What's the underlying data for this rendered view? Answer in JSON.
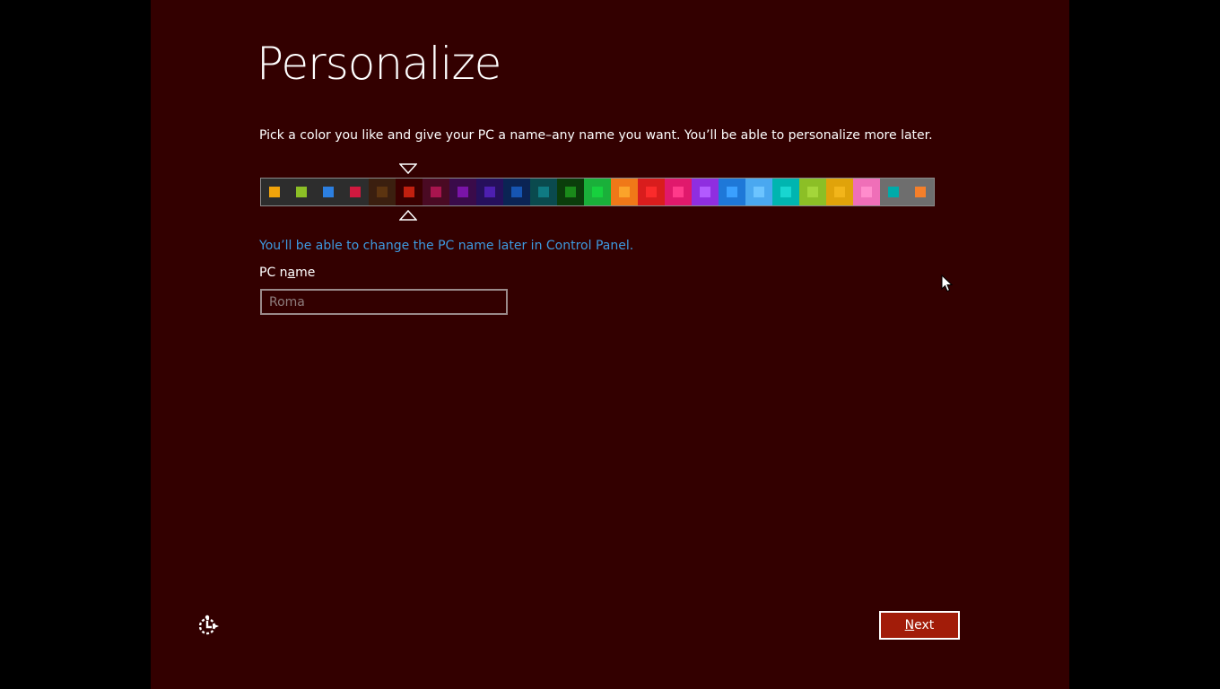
{
  "page": {
    "title": "Personalize",
    "instructions": "Pick a color you like and give your PC a name–any name you want. You’ll be able to personalize more later.",
    "name_hint": "You’ll be able to change the PC name later in Control Panel."
  },
  "pc_name": {
    "label_before": "PC n",
    "label_underlined": "a",
    "label_after": "me",
    "placeholder": "Roma",
    "value": ""
  },
  "colors": {
    "background": "#330000",
    "accent_link": "#3d9ae0",
    "next_button": "#a21c09",
    "selected_index": 5,
    "swatches": [
      {
        "bg": "#2d2d2d",
        "chip": "#f0a30a"
      },
      {
        "bg": "#2d2d2d",
        "chip": "#8cbf26"
      },
      {
        "bg": "#2d2d2d",
        "chip": "#2c7fe0"
      },
      {
        "bg": "#2d2d2d",
        "chip": "#d1193f"
      },
      {
        "bg": "#3b1f0f",
        "chip": "#5c3410"
      },
      {
        "bg": "#3a0000",
        "chip": "#c1200f"
      },
      {
        "bg": "#4a0a23",
        "chip": "#a8154e"
      },
      {
        "bg": "#3a0b4a",
        "chip": "#7a14a8"
      },
      {
        "bg": "#26105c",
        "chip": "#4d1fb0"
      },
      {
        "bg": "#0b2454",
        "chip": "#1655b2"
      },
      {
        "bg": "#0a4a4e",
        "chip": "#0f7a82"
      },
      {
        "bg": "#0b3d0b",
        "chip": "#1a8a1a"
      },
      {
        "bg": "#1ab03a",
        "chip": "#17d03e"
      },
      {
        "bg": "#f07818",
        "chip": "#fba32a"
      },
      {
        "bg": "#d91d1d",
        "chip": "#fa2b2b"
      },
      {
        "bg": "#e0196c",
        "chip": "#ff3a8a"
      },
      {
        "bg": "#8f2ee0",
        "chip": "#b25aff"
      },
      {
        "bg": "#1e78d8",
        "chip": "#3aa0ff"
      },
      {
        "bg": "#4aa8f0",
        "chip": "#6cc4ff"
      },
      {
        "bg": "#00b5b0",
        "chip": "#18d6d0"
      },
      {
        "bg": "#8cbf26",
        "chip": "#a4d63a"
      },
      {
        "bg": "#e0a30a",
        "chip": "#f2b51a"
      },
      {
        "bg": "#ef6fb8",
        "chip": "#ff8ccc"
      },
      {
        "bg": "#6e6e6e",
        "chip": "#00aba9"
      },
      {
        "bg": "#6e6e6e",
        "chip": "#f57f2a"
      }
    ]
  },
  "buttons": {
    "next_underlined": "N",
    "next_rest": "ext"
  },
  "icons": {
    "ease_of_access": "ease-of-access-icon",
    "cursor": "mouse-pointer-icon",
    "selection_top": "selection-pointer-top-icon",
    "selection_bottom": "selection-pointer-bottom-icon"
  }
}
